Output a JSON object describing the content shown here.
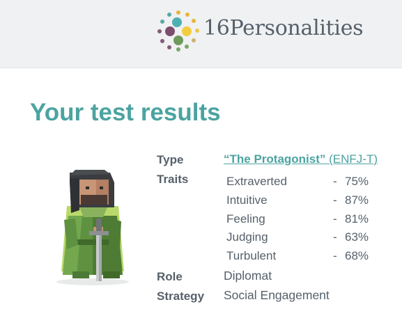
{
  "header": {
    "brand": "16Personalities",
    "logo_icon": "dots-circle-logo-icon",
    "colors": {
      "background": "#f0f1f2",
      "brand_text": "#55606b"
    }
  },
  "main": {
    "title": "Your test results",
    "title_color": "#4ba3a1",
    "avatar_icon": "protagonist-character-avatar",
    "type": {
      "label": "Type",
      "nickname": "“The Protagonist”",
      "code": "(ENFJ-T)"
    },
    "traits": {
      "label": "Traits",
      "items": [
        {
          "name": "Extraverted",
          "dash": "-",
          "percent": "75%"
        },
        {
          "name": "Intuitive",
          "dash": "-",
          "percent": "87%"
        },
        {
          "name": "Feeling",
          "dash": "-",
          "percent": "81%"
        },
        {
          "name": "Judging",
          "dash": "-",
          "percent": "63%"
        },
        {
          "name": "Turbulent",
          "dash": "-",
          "percent": "68%"
        }
      ]
    },
    "role": {
      "label": "Role",
      "value": "Diplomat"
    },
    "strategy": {
      "label": "Strategy",
      "value": "Social Engagement"
    }
  }
}
